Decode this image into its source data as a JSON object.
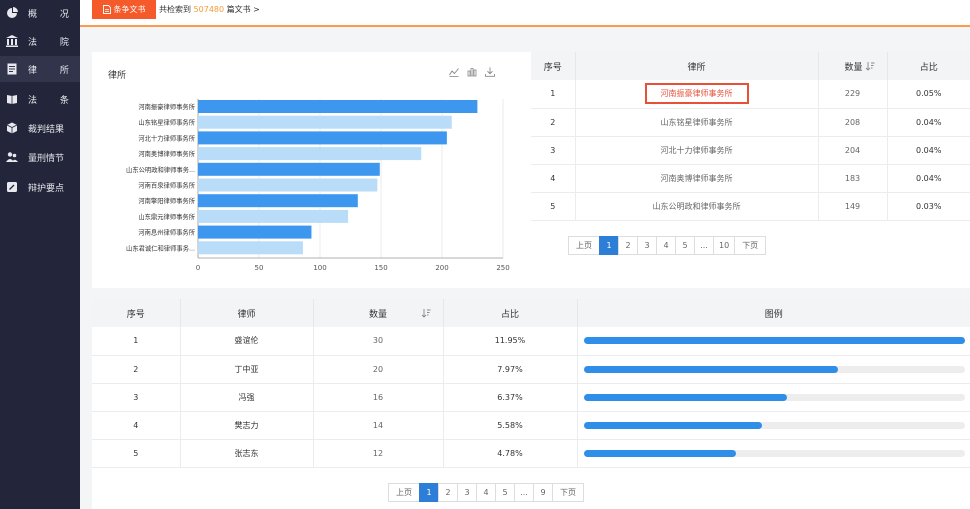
{
  "sidebar": {
    "items": [
      {
        "label": "概 况",
        "icon": "chart-pie-icon",
        "active": false
      },
      {
        "label": "法 院",
        "icon": "court-building-icon",
        "active": false
      },
      {
        "label": "律 所",
        "icon": "firm-document-icon",
        "active": true
      },
      {
        "label": "法 条",
        "icon": "book-icon",
        "active": false
      },
      {
        "label": "裁判结果",
        "icon": "cube-icon",
        "active": false
      },
      {
        "label": "量刑情节",
        "icon": "people-icon",
        "active": false
      },
      {
        "label": "辩护要点",
        "icon": "edit-note-icon",
        "active": false
      }
    ]
  },
  "topbar": {
    "report_label": "条争文书",
    "result_prefix": "共检索到",
    "result_count": "507480",
    "result_suffix": "篇文书 >"
  },
  "firm_chart": {
    "title": "律所",
    "tools": [
      "line-chart-icon",
      "bar-chart-icon",
      "download-icon"
    ]
  },
  "chart_data": {
    "type": "bar",
    "orientation": "horizontal",
    "categories": [
      "河南振豪律师事务所",
      "山东铭星律师事务所",
      "河北十力律师事务所",
      "河南奥博律师事务所",
      "山东公明政和律师事务...",
      "河南百泉律师事务所",
      "河南擎阳律师事务所",
      "山东鼎元律师事务所",
      "河南息州律师事务所",
      "山东君诚仁和律师事务..."
    ],
    "values": [
      229,
      208,
      204,
      183,
      149,
      147,
      131,
      123,
      93,
      86
    ],
    "bar_colors": [
      "#3d97ef",
      "#b9dcf8",
      "#3d97ef",
      "#b9dcf8",
      "#3d97ef",
      "#b9dcf8",
      "#3d97ef",
      "#b9dcf8",
      "#3d97ef",
      "#b9dcf8"
    ],
    "xticks": [
      "0",
      "50",
      "100",
      "150",
      "200",
      "250"
    ],
    "xlim": [
      0,
      250
    ],
    "grid": true
  },
  "firm_table": {
    "headers": {
      "index": "序号",
      "name": "律所",
      "count": "数量",
      "ratio": "占比"
    },
    "rows": [
      {
        "index": "1",
        "name": "河南振豪律师事务所",
        "count": "229",
        "ratio": "0.05%"
      },
      {
        "index": "2",
        "name": "山东铭星律师事务所",
        "count": "208",
        "ratio": "0.04%"
      },
      {
        "index": "3",
        "name": "河北十力律师事务所",
        "count": "204",
        "ratio": "0.04%"
      },
      {
        "index": "4",
        "name": "河南奥博律师事务所",
        "count": "183",
        "ratio": "0.04%"
      },
      {
        "index": "5",
        "name": "山东公明政和律师事务所",
        "count": "149",
        "ratio": "0.03%"
      }
    ],
    "pager": {
      "prev": "上页",
      "pages": [
        "1",
        "2",
        "3",
        "4",
        "5",
        "...",
        "10"
      ],
      "next": "下页",
      "current": "1"
    }
  },
  "lawyer_table": {
    "headers": {
      "index": "序号",
      "name": "律师",
      "count": "数量",
      "ratio": "占比",
      "legend": "图例"
    },
    "rows": [
      {
        "index": "1",
        "name": "盛谊伦",
        "count": "30",
        "ratio": "11.95%",
        "fill": 1.0
      },
      {
        "index": "2",
        "name": "丁中亚",
        "count": "20",
        "ratio": "7.97%",
        "fill": 0.667
      },
      {
        "index": "3",
        "name": "冯强",
        "count": "16",
        "ratio": "6.37%",
        "fill": 0.533
      },
      {
        "index": "4",
        "name": "樊志力",
        "count": "14",
        "ratio": "5.58%",
        "fill": 0.467
      },
      {
        "index": "5",
        "name": "张志东",
        "count": "12",
        "ratio": "4.78%",
        "fill": 0.4
      }
    ],
    "pager": {
      "prev": "上页",
      "pages": [
        "1",
        "2",
        "3",
        "4",
        "5",
        "...",
        "9"
      ],
      "next": "下页",
      "current": "1"
    }
  }
}
